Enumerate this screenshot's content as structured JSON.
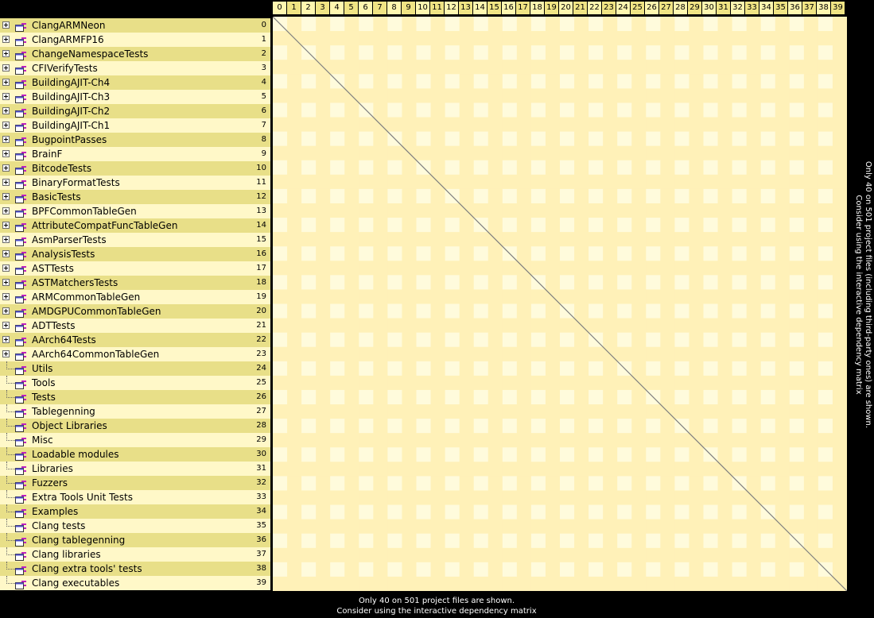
{
  "colors": {
    "background": "#000000",
    "row_light": "#fff8c8",
    "row_dark": "#e8df88",
    "cell_light": "#fffbdc",
    "cell_dark": "#fff1b8",
    "header_light": "#fff7b0",
    "header_dark": "#f0e484",
    "diagonal": "#7f7f7f",
    "hint_text": "#ffffff"
  },
  "columns": [
    "0",
    "1",
    "2",
    "3",
    "4",
    "5",
    "6",
    "7",
    "8",
    "9",
    "10",
    "11",
    "12",
    "13",
    "14",
    "15",
    "16",
    "17",
    "18",
    "19",
    "20",
    "21",
    "22",
    "23",
    "24",
    "25",
    "26",
    "27",
    "28",
    "29",
    "30",
    "31",
    "32",
    "33",
    "34",
    "35",
    "36",
    "37",
    "38",
    "39"
  ],
  "rows": [
    {
      "name": "ClangARMNeon",
      "index": "0",
      "expandable": true
    },
    {
      "name": "ClangARMFP16",
      "index": "1",
      "expandable": true
    },
    {
      "name": "ChangeNamespaceTests",
      "index": "2",
      "expandable": true
    },
    {
      "name": "CFIVerifyTests",
      "index": "3",
      "expandable": true
    },
    {
      "name": "BuildingAJIT-Ch4",
      "index": "4",
      "expandable": true
    },
    {
      "name": "BuildingAJIT-Ch3",
      "index": "5",
      "expandable": true
    },
    {
      "name": "BuildingAJIT-Ch2",
      "index": "6",
      "expandable": true
    },
    {
      "name": "BuildingAJIT-Ch1",
      "index": "7",
      "expandable": true
    },
    {
      "name": "BugpointPasses",
      "index": "8",
      "expandable": true
    },
    {
      "name": "BrainF",
      "index": "9",
      "expandable": true
    },
    {
      "name": "BitcodeTests",
      "index": "10",
      "expandable": true
    },
    {
      "name": "BinaryFormatTests",
      "index": "11",
      "expandable": true
    },
    {
      "name": "BasicTests",
      "index": "12",
      "expandable": true
    },
    {
      "name": "BPFCommonTableGen",
      "index": "13",
      "expandable": true
    },
    {
      "name": "AttributeCompatFuncTableGen",
      "index": "14",
      "expandable": true
    },
    {
      "name": "AsmParserTests",
      "index": "15",
      "expandable": true
    },
    {
      "name": "AnalysisTests",
      "index": "16",
      "expandable": true
    },
    {
      "name": "ASTTests",
      "index": "17",
      "expandable": true
    },
    {
      "name": "ASTMatchersTests",
      "index": "18",
      "expandable": true
    },
    {
      "name": "ARMCommonTableGen",
      "index": "19",
      "expandable": true
    },
    {
      "name": "AMDGPUCommonTableGen",
      "index": "20",
      "expandable": true
    },
    {
      "name": "ADTTests",
      "index": "21",
      "expandable": true
    },
    {
      "name": "AArch64Tests",
      "index": "22",
      "expandable": true
    },
    {
      "name": "AArch64CommonTableGen",
      "index": "23",
      "expandable": true
    },
    {
      "name": "Utils",
      "index": "24",
      "expandable": false
    },
    {
      "name": "Tools",
      "index": "25",
      "expandable": false
    },
    {
      "name": "Tests",
      "index": "26",
      "expandable": false
    },
    {
      "name": "Tablegenning",
      "index": "27",
      "expandable": false
    },
    {
      "name": "Object Libraries",
      "index": "28",
      "expandable": false
    },
    {
      "name": "Misc",
      "index": "29",
      "expandable": false
    },
    {
      "name": "Loadable modules",
      "index": "30",
      "expandable": false
    },
    {
      "name": "Libraries",
      "index": "31",
      "expandable": false
    },
    {
      "name": "Fuzzers",
      "index": "32",
      "expandable": false
    },
    {
      "name": "Extra Tools Unit Tests",
      "index": "33",
      "expandable": false
    },
    {
      "name": "Examples",
      "index": "34",
      "expandable": false
    },
    {
      "name": "Clang tests",
      "index": "35",
      "expandable": false
    },
    {
      "name": "Clang tablegenning",
      "index": "36",
      "expandable": false
    },
    {
      "name": "Clang libraries",
      "index": "37",
      "expandable": false
    },
    {
      "name": "Clang extra tools' tests",
      "index": "38",
      "expandable": false
    },
    {
      "name": "Clang executables",
      "index": "39",
      "expandable": false
    }
  ],
  "hints": {
    "vertical_line1": "Only 40 on 501 project files (including third-party ones) are shown.",
    "vertical_line2": "Consider using the interactive dependency matrix",
    "bottom_line1": "Only 40 on 501 project files are shown.",
    "bottom_line2": "Consider using the interactive dependency matrix"
  }
}
